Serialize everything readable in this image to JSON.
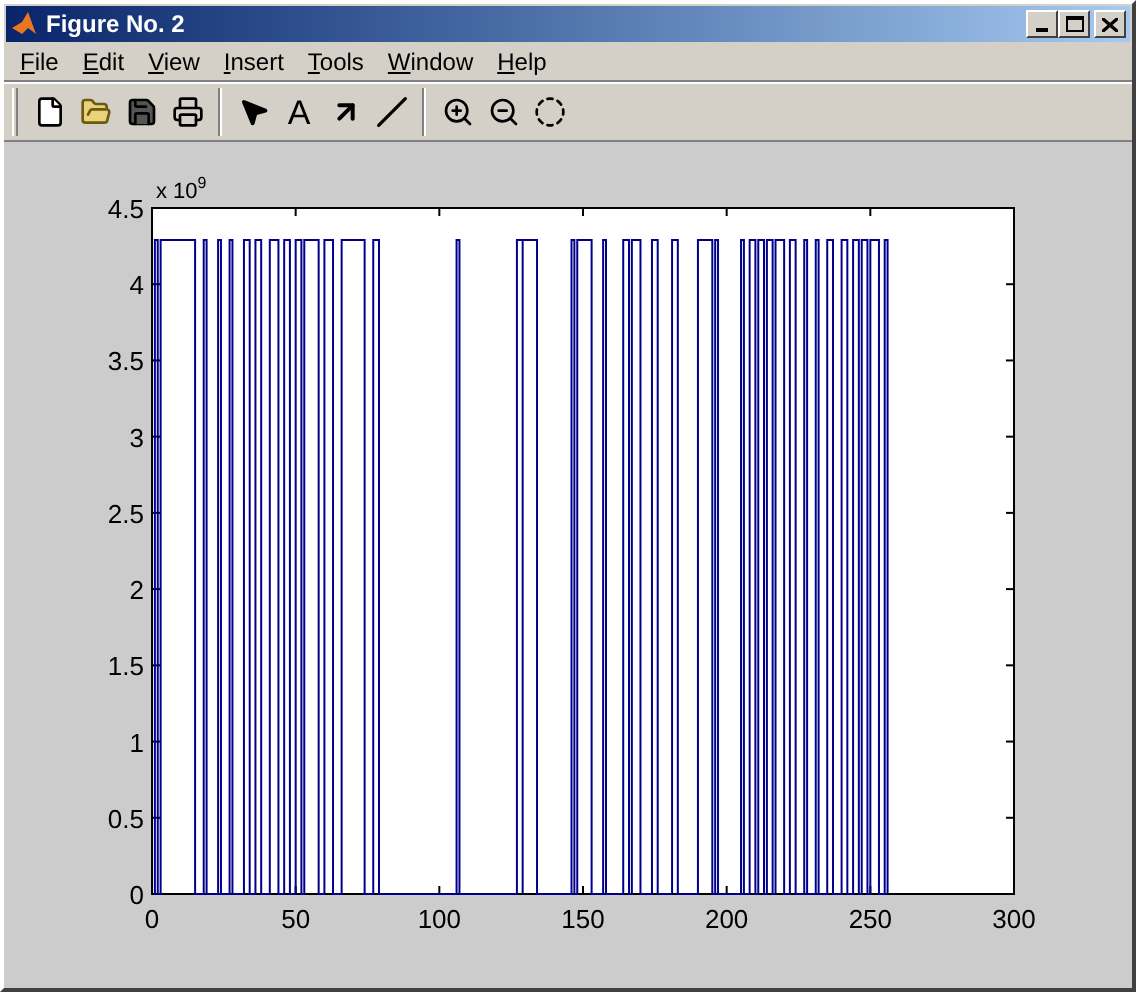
{
  "window": {
    "title": "Figure No. 2"
  },
  "menu": [
    {
      "label": "File"
    },
    {
      "label": "Edit"
    },
    {
      "label": "View"
    },
    {
      "label": "Insert"
    },
    {
      "label": "Tools"
    },
    {
      "label": "Window"
    },
    {
      "label": "Help"
    }
  ],
  "toolbar": [
    {
      "kind": "new"
    },
    {
      "kind": "open"
    },
    {
      "kind": "save"
    },
    {
      "kind": "print"
    },
    {
      "kind": "separator"
    },
    {
      "kind": "select"
    },
    {
      "kind": "text",
      "label": "A"
    },
    {
      "kind": "arrow"
    },
    {
      "kind": "line"
    },
    {
      "kind": "separator"
    },
    {
      "kind": "zoom_in"
    },
    {
      "kind": "zoom_out"
    },
    {
      "kind": "rotate"
    }
  ],
  "axes": {
    "exponent": {
      "base": "x 10",
      "power": "9"
    },
    "yticks": [
      "4.5",
      "4",
      "3.5",
      "3",
      "2.5",
      "2",
      "1.5",
      "1",
      "0.5",
      "0"
    ],
    "xticks": [
      "0",
      "50",
      "100",
      "150",
      "200",
      "250",
      "300"
    ]
  }
}
